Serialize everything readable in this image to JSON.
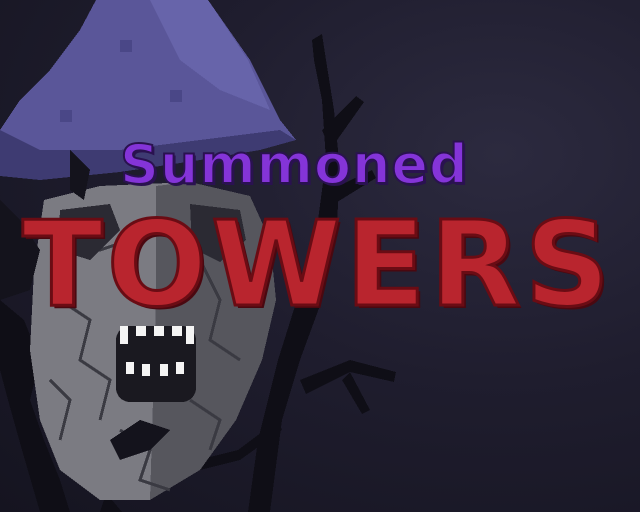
{
  "title": {
    "line1": "Summoned",
    "line2": "TOWERS"
  },
  "colors": {
    "background": "#1c1a29",
    "hat": "#5a5699",
    "stone": "#8a8a90",
    "title_purple": "#8434d8",
    "title_red": "#b9252e"
  },
  "icons": {
    "tower": "wizard-tower-icon",
    "branches": "dead-branches-icon"
  }
}
